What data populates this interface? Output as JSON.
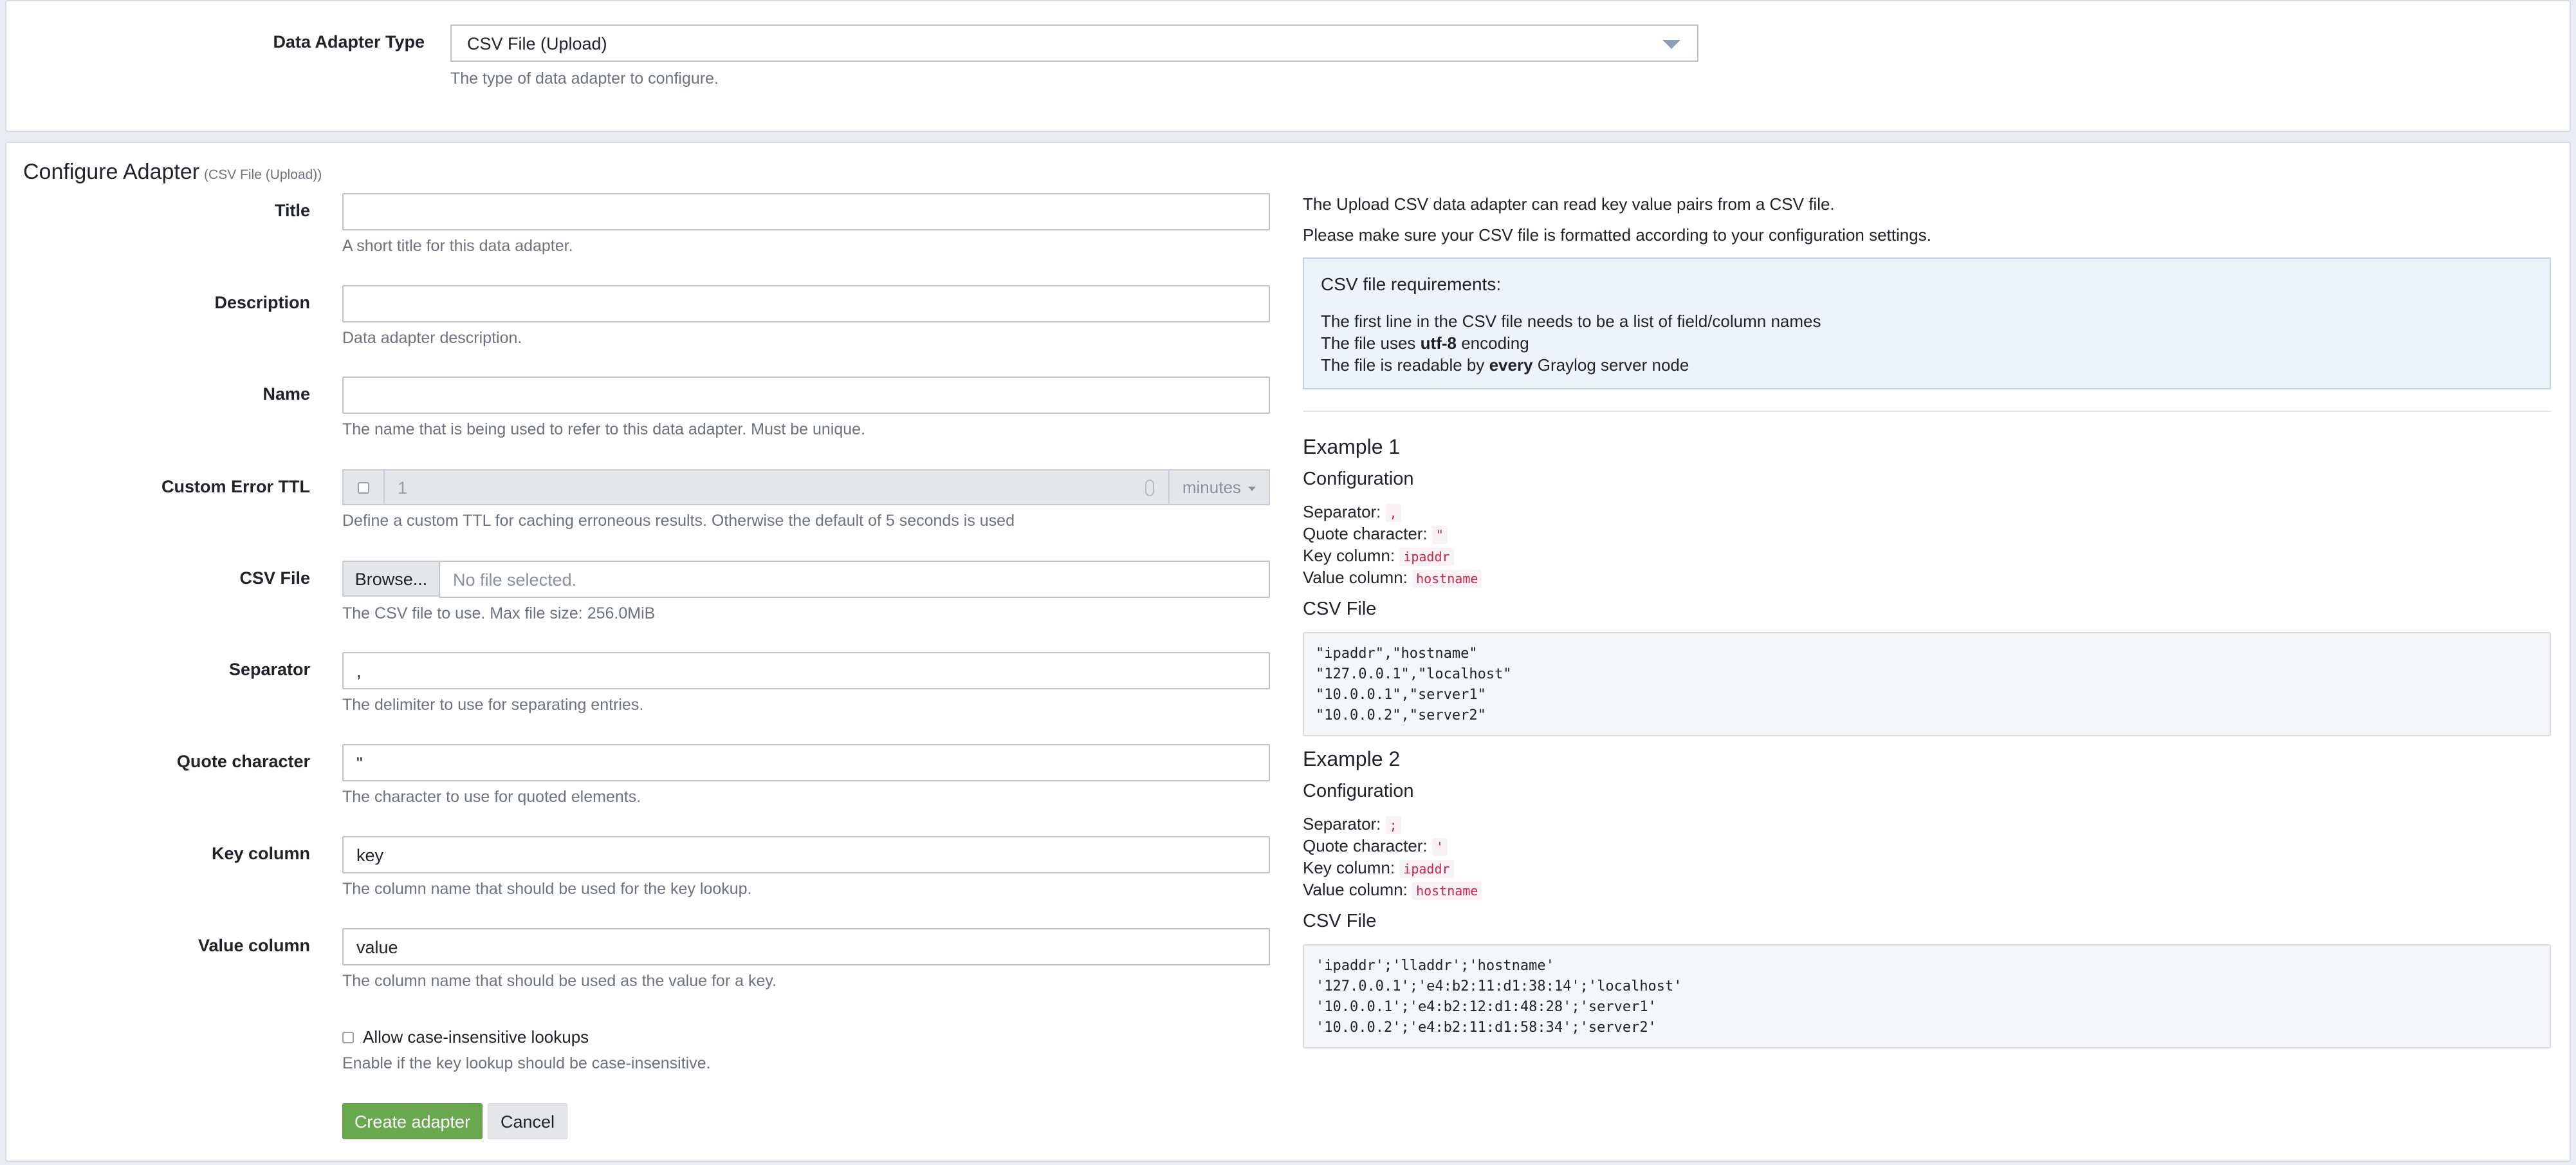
{
  "adapter_type": {
    "label": "Data Adapter Type",
    "value": "CSV File (Upload)",
    "help": "The type of data adapter to configure."
  },
  "configure": {
    "title": "Configure Adapter",
    "subtitle": "(CSV File (Upload))"
  },
  "form": {
    "title": {
      "label": "Title",
      "value": "",
      "help": "A short title for this data adapter."
    },
    "description": {
      "label": "Description",
      "value": "",
      "help": "Data adapter description."
    },
    "name": {
      "label": "Name",
      "value": "",
      "help": "The name that is being used to refer to this data adapter. Must be unique."
    },
    "custom_error_ttl": {
      "label": "Custom Error TTL",
      "value": "1",
      "unit": "minutes",
      "help": "Define a custom TTL for caching erroneous results. Otherwise the default of 5 seconds is used"
    },
    "csv_file": {
      "label": "CSV File",
      "browse": "Browse...",
      "placeholder": "No file selected.",
      "help": "The CSV file to use. Max file size: 256.0MiB"
    },
    "separator": {
      "label": "Separator",
      "value": ",",
      "help": "The delimiter to use for separating entries."
    },
    "quote_character": {
      "label": "Quote character",
      "value": "\"",
      "help": "The character to use for quoted elements."
    },
    "key_column": {
      "label": "Key column",
      "value": "key",
      "help": "The column name that should be used for the key lookup."
    },
    "value_column": {
      "label": "Value column",
      "value": "value",
      "help": "The column name that should be used as the value for a key."
    },
    "case_insensitive": {
      "label": "Allow case-insensitive lookups",
      "help": "Enable if the key lookup should be case-insensitive."
    },
    "create_button": "Create adapter",
    "cancel_button": "Cancel"
  },
  "docs": {
    "intro1": "The Upload CSV data adapter can read key value pairs from a CSV file.",
    "intro2": "Please make sure your CSV file is formatted according to your configuration settings.",
    "requirements": {
      "heading": "CSV file requirements:",
      "line1": "The first line in the CSV file needs to be a list of field/column names",
      "line2_pre": "The file uses ",
      "line2_bold": "utf-8",
      "line2_post": " encoding",
      "line3_pre": "The file is readable by ",
      "line3_bold": "every",
      "line3_post": " Graylog server node"
    },
    "example1": {
      "heading": "Example 1",
      "config_heading": "Configuration",
      "separator_label": "Separator:",
      "separator": ",",
      "quote_label": "Quote character:",
      "quote": "\"",
      "key_label": "Key column:",
      "key": "ipaddr",
      "value_label": "Value column:",
      "value": "hostname",
      "csv_heading": "CSV File",
      "csv": "\"ipaddr\",\"hostname\"\n\"127.0.0.1\",\"localhost\"\n\"10.0.0.1\",\"server1\"\n\"10.0.0.2\",\"server2\""
    },
    "example2": {
      "heading": "Example 2",
      "config_heading": "Configuration",
      "separator_label": "Separator:",
      "separator": ";",
      "quote_label": "Quote character:",
      "quote": "'",
      "key_label": "Key column:",
      "key": "ipaddr",
      "value_label": "Value column:",
      "value": "hostname",
      "csv_heading": "CSV File",
      "csv": "'ipaddr';'lladdr';'hostname'\n'127.0.0.1';'e4:b2:11:d1:38:14';'localhost'\n'10.0.0.1';'e4:b2:12:d1:48:28';'server1'\n'10.0.0.2';'e4:b2:11:d1:58:34';'server2'"
    }
  },
  "colors": {
    "primary_button": "#6aa84f",
    "code_text": "#c7254e",
    "info_box": "#eef3fb"
  },
  "icons": {
    "select_caret": "triangle-down-icon",
    "unit_caret": "caret-down-icon",
    "number_spinner": "spinner-icon"
  }
}
